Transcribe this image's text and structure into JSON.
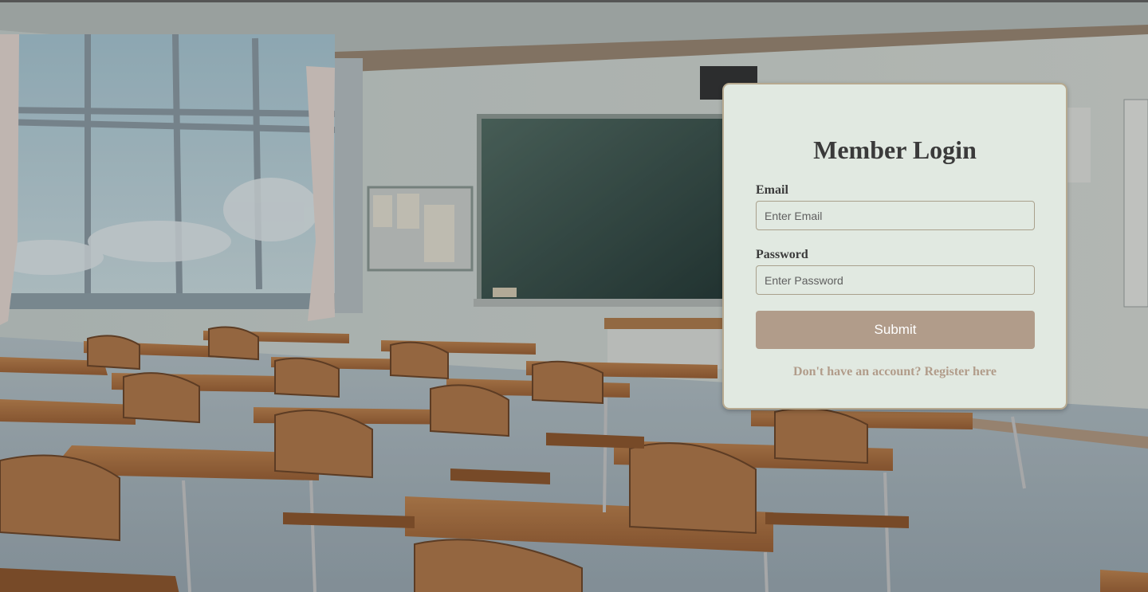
{
  "login": {
    "title": "Member Login",
    "email_label": "Email",
    "email_placeholder": "Enter Email",
    "email_value": "",
    "password_label": "Password",
    "password_placeholder": "Enter Password",
    "password_value": "",
    "submit_label": "Submit",
    "register_link": "Don't have an account? Register here"
  },
  "colors": {
    "card_background": "#e1e9e1",
    "card_border": "#b6a98f",
    "button": "#b19c8a",
    "link": "#b19c8a",
    "text": "#3a3a3a"
  }
}
